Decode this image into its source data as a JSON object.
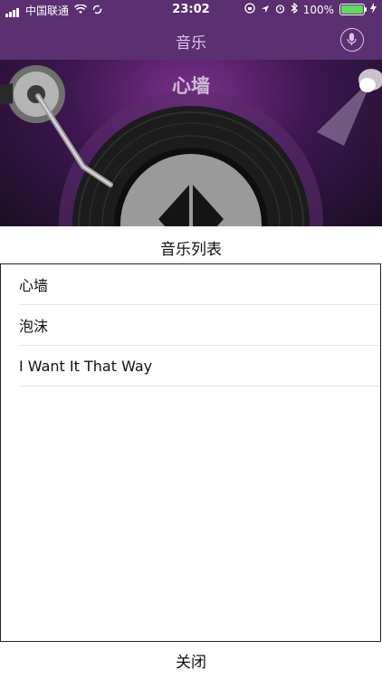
{
  "status_bar": {
    "carrier": "中国联通",
    "time": "23:02",
    "battery_percent": "100%",
    "battery_level": 1.0
  },
  "nav": {
    "title": "音乐"
  },
  "player": {
    "current_song": "心墙"
  },
  "playlist": {
    "title": "音乐列表",
    "items": [
      {
        "label": "心墙"
      },
      {
        "label": "泡沫"
      },
      {
        "label": "I Want It That Way"
      }
    ],
    "close_label": "关闭"
  },
  "icons": {
    "status_left": [
      "signal-icon",
      "wifi-icon",
      "sync-icon"
    ],
    "status_right": [
      "screen-lock-icon",
      "location-icon",
      "alarm-icon",
      "bluetooth-icon",
      "battery-icon",
      "charging-icon"
    ],
    "nav_right": "microphone-icon",
    "record_center": "play-pause-icon"
  },
  "colors": {
    "header_bg": "#5a3071",
    "battery_fill": "#5ddc5d"
  }
}
